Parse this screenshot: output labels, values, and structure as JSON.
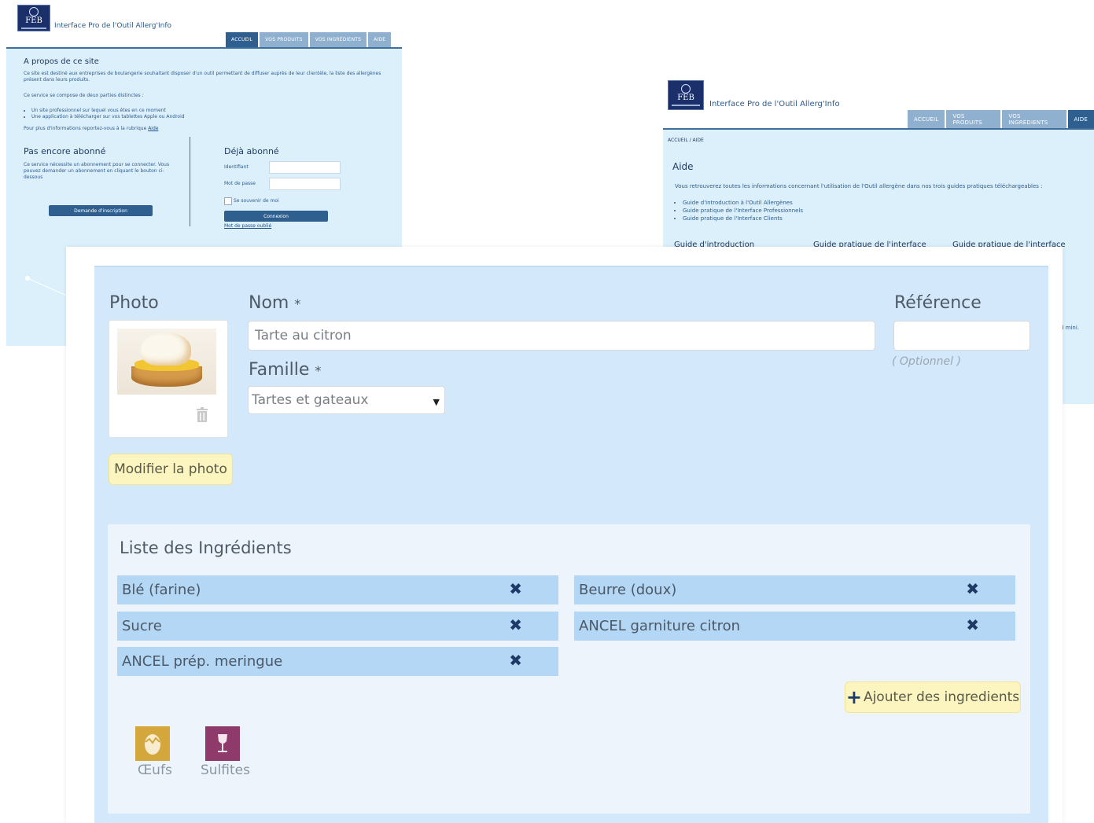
{
  "home_window": {
    "logo_text": "FEB",
    "app_title": "Interface Pro de l'Outil Allerg'Info",
    "tabs": [
      "Accueil",
      "Vos produits",
      "Vos ingrédients",
      "Aide"
    ],
    "about_title": "A propos de ce site",
    "about_text": "Ce site est destiné aux entreprises de boulangerie souhaitant disposer d'un outil permettant de diffuser auprès de leur clientèle, la liste des allergènes présent dans leurs produits.",
    "service_intro": "Ce service se compose de deux parties distinctes :",
    "service_items": [
      "Un site professionnel sur lequel vous êtes en ce moment",
      "Une application à télécharger sur vos tablettes Apple ou Android"
    ],
    "more_info": "Pour plus d'informations reportez-vous à la rubrique",
    "more_info_link": "Aide",
    "not_subscribed_title": "Pas encore abonné",
    "not_subscribed_text": "Ce service nécessite un abonnement pour se connecter. Vous pouvez demander un abonnement en cliquant le bouton ci-dessous",
    "subscribe_button": "Demande d'inscription",
    "subscribed_title": "Déjà abonné",
    "login_label": "Identifiant",
    "password_label": "Mot de passe",
    "remember_label": "Se souvenir de moi",
    "connect_button": "Connexion",
    "forgot_link": "Mot de passe oublié"
  },
  "aide_window": {
    "logo_text": "FEB",
    "app_title": "Interface Pro de l'Outil Allerg'Info",
    "tabs": [
      "Accueil",
      "Vos produits",
      "Vos ingrédients",
      "Aide"
    ],
    "breadcrumb": "ACCUEIL / AIDE",
    "title": "Aide",
    "intro": "Vous retrouverez toutes les informations concernant l'utilisation de l'Outil allergène dans nos trois guides pratiques téléchargeables :",
    "guides": [
      "Guide d'introduction à l'Outil Allergènes",
      "Guide pratique de l'Interface Professionnels",
      "Guide pratique de l'Interface Clients"
    ],
    "col_titles": [
      "Guide d'introduction",
      "Guide pratique de l'interface",
      "Guide pratique de l'interface"
    ],
    "side_fragment": "d mini."
  },
  "product_form": {
    "photo_label": "Photo",
    "name_label": "Nom",
    "required_mark": "*",
    "name_value": "Tarte au citron",
    "reference_label": "Référence",
    "reference_value": "",
    "reference_hint": "( Optionnel )",
    "family_label": "Famille",
    "family_value": "Tartes et gateaux",
    "modify_photo_button": "Modifier la photo",
    "ingredients_title": "Liste des Ingrédients",
    "ingredients_left": [
      "Blé (farine)",
      "Sucre",
      "ANCEL prép. meringue"
    ],
    "ingredients_right": [
      "Beurre (doux)",
      "ANCEL garniture citron"
    ],
    "remove_glyph": "✖",
    "add_ingredients_button": "Ajouter des ingredients",
    "add_glyph": "+",
    "allergens": [
      {
        "label": "Œufs",
        "color": "#d4a73c",
        "icon": "egg-icon"
      },
      {
        "label": "Sulfites",
        "color": "#8e3a6a",
        "icon": "wine-glass-icon"
      }
    ]
  }
}
